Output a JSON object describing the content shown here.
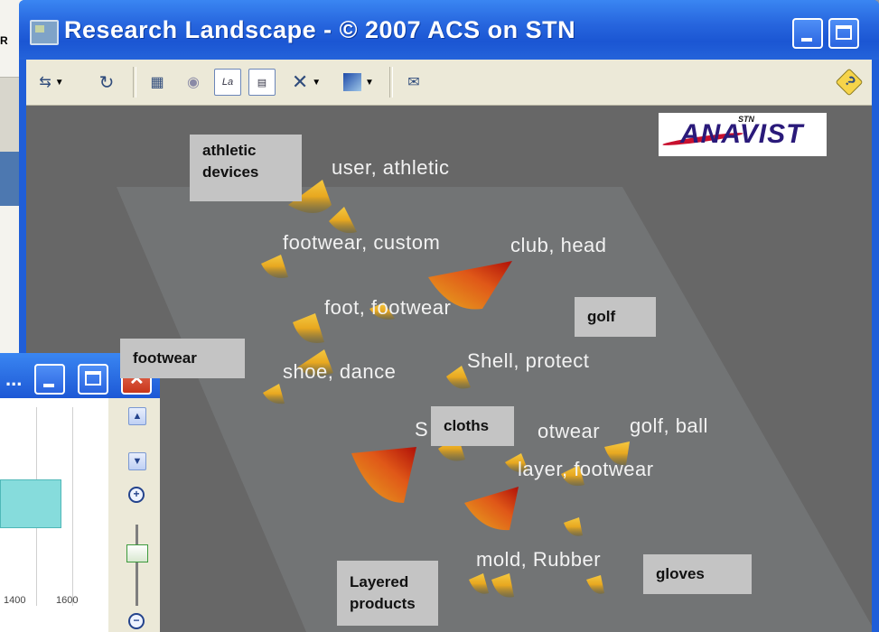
{
  "background_window": {
    "partial_label": "R"
  },
  "window": {
    "title": "Research Landscape - © 2007 ACS on STN",
    "minimize_label": "",
    "maximize_label": ""
  },
  "toolbar": {
    "icons": [
      "navigate-icon",
      "rotate-icon",
      "map-view-icon",
      "camera-icon",
      "label-icon",
      "label-select-icon",
      "clear-labels-icon",
      "color-scheme-icon",
      "export-icon",
      "help-icon"
    ],
    "label_button_text": "La",
    "help_glyph": "?"
  },
  "logo": {
    "prefix": "STN",
    "word": "ANAVIST"
  },
  "landscape_labels": [
    "user, athletic",
    "footwear, custom",
    "club, head",
    "foot, footwear",
    "shoe, dance",
    "Shell, protect",
    "S",
    "otwear",
    "golf, ball",
    "layer, footwear",
    "mold, Rubber"
  ],
  "callouts": {
    "athletic_devices": "athletic devices",
    "golf": "golf",
    "footwear": "footwear",
    "cloths": "cloths",
    "gloves": "gloves",
    "layered_products": "Layered products"
  },
  "child_window": {
    "title": "...",
    "axis_ticks": [
      "1400",
      "1600"
    ]
  },
  "colors": {
    "titlebar_blue": "#2766de",
    "canvas_gray": "#676767",
    "peak_yellow": "#f0b020",
    "peak_red": "#c02010",
    "callout_gray": "#c4c4c4"
  }
}
